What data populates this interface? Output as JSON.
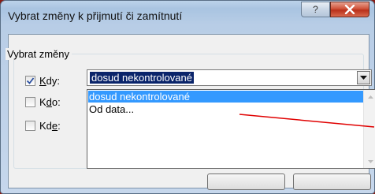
{
  "window": {
    "title": "Vybrat změny k přijmutí či zamítnutí",
    "help_label": "?",
    "close_label": "x"
  },
  "group": {
    "legend": "Vybrat změny",
    "rows": [
      {
        "checked": true,
        "pre": "",
        "u": "K",
        "post": "dy:"
      },
      {
        "checked": false,
        "pre": "K",
        "u": "d",
        "post": "o:"
      },
      {
        "checked": false,
        "pre": "Kd",
        "u": "e",
        "post": ":"
      }
    ]
  },
  "when_combo": {
    "value": "dosud nekontrolované",
    "options": [
      "dosud nekontrolované",
      "Od data..."
    ],
    "selected_index": 0
  },
  "colors": {
    "selection": "#3399ff",
    "combo_selection": "#0a246a",
    "annotation_line": "#e00000",
    "frame": "#8a1a12"
  }
}
